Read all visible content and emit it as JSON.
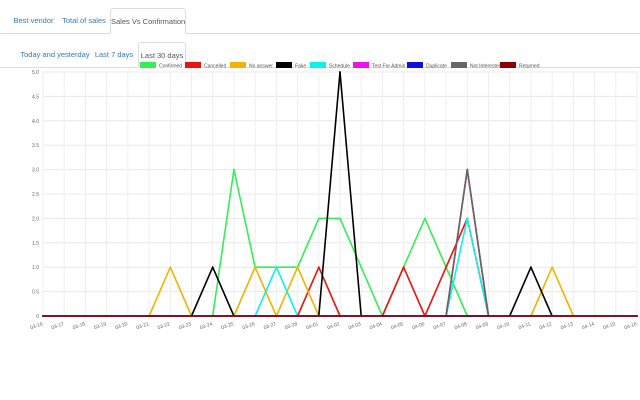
{
  "report_tabs": [
    {
      "label": "Best vendor",
      "active": false
    },
    {
      "label": "Total of sales",
      "active": false
    },
    {
      "label": "Sales Vs Confirmation",
      "active": true
    }
  ],
  "range_tabs": [
    {
      "label": "Today and yesterday",
      "active": false
    },
    {
      "label": "Last 7 days",
      "active": false
    },
    {
      "label": "Last 30 days",
      "active": true
    }
  ],
  "chart_data": {
    "type": "line",
    "x": [
      "03-16",
      "03-17",
      "03-18",
      "03-19",
      "03-20",
      "03-21",
      "03-22",
      "03-23",
      "03-24",
      "03-25",
      "03-26",
      "03-27",
      "03-28",
      "04-01",
      "04-02",
      "04-03",
      "04-04",
      "04-05",
      "04-06",
      "04-07",
      "04-08",
      "04-09",
      "04-10",
      "04-11",
      "04-12",
      "04-13",
      "04-14",
      "04-15",
      "04-16"
    ],
    "ylim": [
      0,
      5
    ],
    "yticks": [
      "0",
      "0.5",
      "1.0",
      "1.5",
      "2.0",
      "2.5",
      "3.0",
      "3.5",
      "4.0",
      "4.5",
      "5.0"
    ],
    "grid": true,
    "legend_position": "top",
    "series": [
      {
        "name": "Confirmed",
        "color": "#33ee55",
        "values": [
          0,
          0,
          0,
          0,
          0,
          0,
          0,
          0,
          0,
          3,
          1,
          1,
          1,
          2,
          2,
          1,
          0,
          1,
          2,
          1,
          0,
          0,
          0,
          0,
          0,
          0,
          0,
          0,
          0
        ]
      },
      {
        "name": "Cancelled",
        "color": "#ee1111",
        "values": [
          0,
          0,
          0,
          0,
          0,
          0,
          0,
          0,
          0,
          0,
          0,
          0,
          0,
          1,
          0,
          0,
          0,
          1,
          0,
          1,
          2,
          0,
          0,
          0,
          0,
          0,
          0,
          0,
          0
        ]
      },
      {
        "name": "No answer",
        "color": "#f0b400",
        "values": [
          0,
          0,
          0,
          0,
          0,
          0,
          1,
          0,
          0,
          0,
          1,
          0,
          1,
          0,
          0,
          0,
          0,
          0,
          0,
          0,
          3,
          0,
          0,
          0,
          1,
          0,
          0,
          0,
          0
        ]
      },
      {
        "name": "Fake",
        "color": "#000000",
        "values": [
          0,
          0,
          0,
          0,
          0,
          0,
          0,
          0,
          1,
          0,
          0,
          0,
          0,
          0,
          5,
          0,
          0,
          0,
          0,
          0,
          0,
          0,
          0,
          1,
          0,
          0,
          0,
          0,
          0
        ]
      },
      {
        "name": "Schedule",
        "color": "#11eeee",
        "values": [
          0,
          0,
          0,
          0,
          0,
          0,
          0,
          0,
          0,
          0,
          0,
          1,
          0,
          0,
          0,
          0,
          0,
          0,
          0,
          0,
          2,
          0,
          0,
          0,
          0,
          0,
          0,
          0,
          0
        ]
      },
      {
        "name": "Test For Admin",
        "color": "#ee11ee",
        "values": [
          0,
          0,
          0,
          0,
          0,
          0,
          0,
          0,
          0,
          0,
          0,
          0,
          0,
          0,
          0,
          0,
          0,
          0,
          0,
          0,
          3,
          0,
          0,
          0,
          0,
          0,
          0,
          0,
          0
        ]
      },
      {
        "name": "Duplicate",
        "color": "#1111dd",
        "values": [
          0,
          0,
          0,
          0,
          0,
          0,
          0,
          0,
          0,
          0,
          0,
          0,
          0,
          0,
          0,
          0,
          0,
          0,
          0,
          0,
          0,
          0,
          0,
          0,
          0,
          0,
          0,
          0,
          0
        ]
      },
      {
        "name": "Not Interested",
        "color": "#666666",
        "values": [
          0,
          0,
          0,
          0,
          0,
          0,
          0,
          0,
          0,
          0,
          0,
          0,
          0,
          0,
          0,
          0,
          0,
          0,
          0,
          0,
          3,
          0,
          0,
          0,
          0,
          0,
          0,
          0,
          0
        ]
      },
      {
        "name": "Returned",
        "color": "#8b0000",
        "values": [
          0,
          0,
          0,
          0,
          0,
          0,
          0,
          0,
          0,
          0,
          0,
          0,
          0,
          0,
          0,
          0,
          0,
          0,
          0,
          0,
          0,
          0,
          0,
          0,
          0,
          0,
          0,
          0,
          0
        ]
      }
    ]
  }
}
